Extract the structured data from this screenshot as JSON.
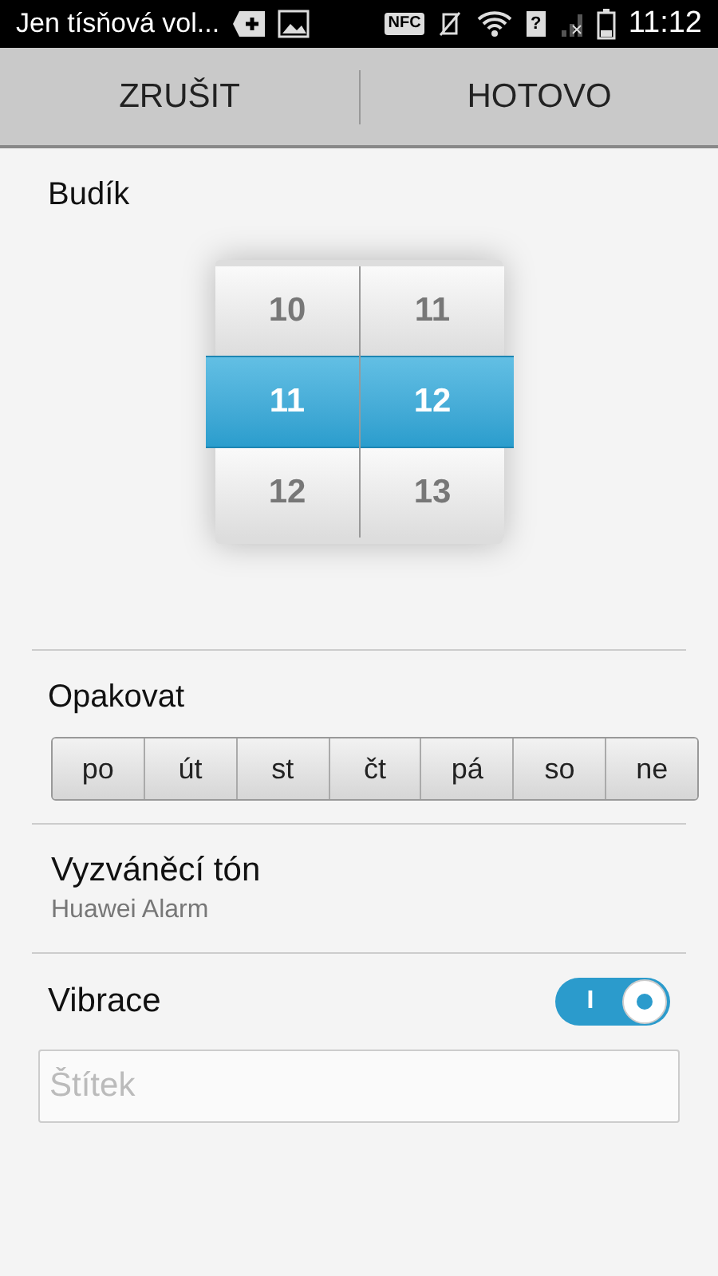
{
  "status_bar": {
    "notification": "Jen tísňová vol...",
    "nfc": "NFC",
    "sim": "?",
    "time": "11:12"
  },
  "action_bar": {
    "buttons": [
      "ZRUŠIT",
      "HOTOVO"
    ]
  },
  "alarm": {
    "title": "Budík",
    "picker": {
      "columns": [
        {
          "values": [
            {
              "text": "10",
              "selected": false
            },
            {
              "text": "11",
              "selected": true
            },
            {
              "text": "12",
              "selected": false
            }
          ]
        },
        {
          "values": [
            {
              "text": "11",
              "selected": false
            },
            {
              "text": "12",
              "selected": true
            },
            {
              "text": "13",
              "selected": false
            }
          ]
        }
      ]
    }
  },
  "repeat": {
    "title": "Opakovat",
    "days": [
      {
        "label": "po",
        "selected": false
      },
      {
        "label": "út",
        "selected": false
      },
      {
        "label": "st",
        "selected": false
      },
      {
        "label": "čt",
        "selected": false
      },
      {
        "label": "pá",
        "selected": false
      },
      {
        "label": "so",
        "selected": false
      },
      {
        "label": "ne",
        "selected": false
      }
    ]
  },
  "ringtone": {
    "title": "Vyzváněcí tón",
    "value": "Huawei Alarm"
  },
  "vibration": {
    "title": "Vibrace",
    "on": true,
    "switch_text": "I"
  },
  "label_field": {
    "placeholder": "Štítek"
  }
}
